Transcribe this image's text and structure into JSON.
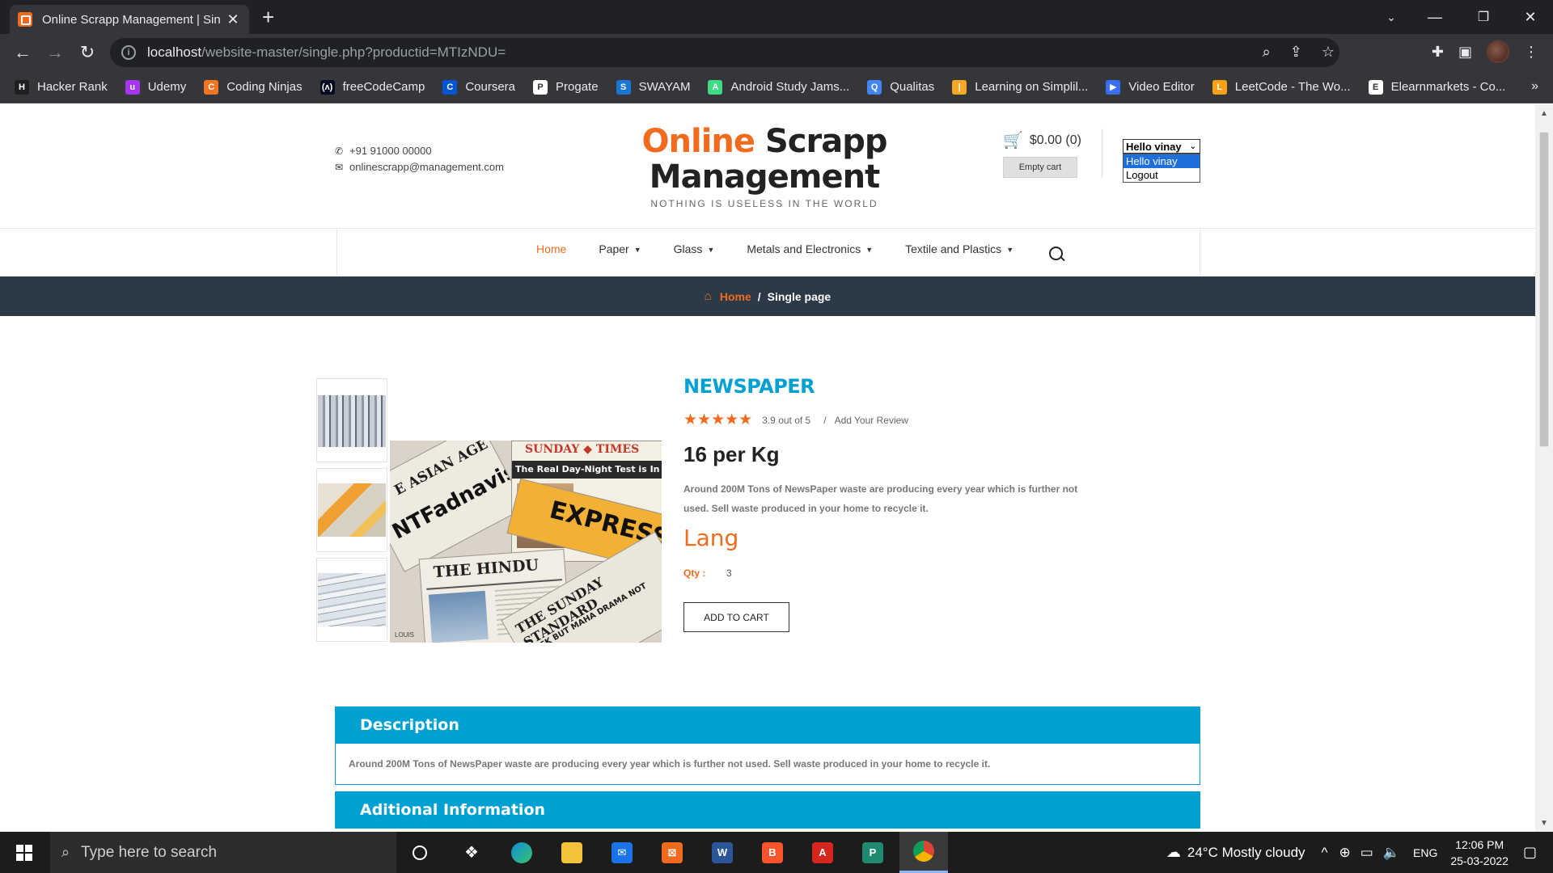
{
  "browser": {
    "tab_title": "Online Scrapp Management | Sin",
    "url_host": "localhost",
    "url_path": "/website-master/single.php?productid=MTIzNDU=",
    "bookmarks": [
      {
        "label": "Hacker Rank",
        "icon": "hackerrank-icon",
        "color": "#1f1f1f",
        "glyph": "H"
      },
      {
        "label": "Udemy",
        "icon": "udemy-icon",
        "color": "#a435f0",
        "glyph": "u"
      },
      {
        "label": "Coding Ninjas",
        "icon": "codingninjas-icon",
        "color": "#f47521",
        "glyph": "C"
      },
      {
        "label": "freeCodeCamp",
        "icon": "freecodecamp-icon",
        "color": "#0a0a23",
        "glyph": "(ʌ)"
      },
      {
        "label": "Coursera",
        "icon": "coursera-icon",
        "color": "#0056d2",
        "glyph": "C"
      },
      {
        "label": "Progate",
        "icon": "progate-icon",
        "color": "#ffffff",
        "glyph": "P"
      },
      {
        "label": "SWAYAM",
        "icon": "swayam-icon",
        "color": "#1976d2",
        "glyph": "S"
      },
      {
        "label": "Android Study Jams...",
        "icon": "android-icon",
        "color": "#3ddc84",
        "glyph": "A"
      },
      {
        "label": "Qualitas",
        "icon": "qualitas-icon",
        "color": "#4285f4",
        "glyph": "Q"
      },
      {
        "label": "Learning on Simplil...",
        "icon": "simplilearn-icon",
        "color": "#f9a825",
        "glyph": "|"
      },
      {
        "label": "Video Editor",
        "icon": "video-editor-icon",
        "color": "#3b6ef5",
        "glyph": "▶"
      },
      {
        "label": "LeetCode - The Wo...",
        "icon": "leetcode-icon",
        "color": "#ffa116",
        "glyph": "L"
      },
      {
        "label": "Elearnmarkets - Co...",
        "icon": "elearnmarkets-icon",
        "color": "#ffffff",
        "glyph": "E"
      }
    ]
  },
  "header": {
    "phone": "+91 91000 00000",
    "email": "onlinescrapp@management.com",
    "logo_word1": "Online",
    "logo_word2": "Scrapp",
    "logo_line2": "Management",
    "tagline": "NOTHING IS USELESS IN THE WORLD",
    "cart_amount": "$0.00 (0)",
    "empty_cart": "Empty cart",
    "user_select": "Hello vinay",
    "user_options": [
      "Hello vinay",
      "Logout"
    ]
  },
  "nav": {
    "items": [
      {
        "label": "Home",
        "caret": false
      },
      {
        "label": "Paper",
        "caret": true
      },
      {
        "label": "Glass",
        "caret": true
      },
      {
        "label": "Metals and Electronics",
        "caret": true
      },
      {
        "label": "Textile and Plastics",
        "caret": true
      }
    ]
  },
  "breadcrumb": {
    "home": "Home",
    "separator": "/",
    "current": "Single page"
  },
  "product": {
    "title": "NEWSPAPER",
    "rating_value": 5,
    "rating_text": "3.9 out of 5",
    "review_sep": "/",
    "review_link": "Add Your Review",
    "price": "16 per Kg",
    "description": "Around 200M Tons of NewsPaper waste are producing every year which is further not used. Sell waste produced in your home to recycle it.",
    "lang": "Lang",
    "qty_label": "Qty :",
    "qty_value": "3",
    "add_to_cart": "ADD TO CART",
    "image_texts": {
      "asian_age": "E ASIAN AGE",
      "fadnavis": "NTFadnavis",
      "sunday_times": "SUNDAY ◆ TIMES",
      "test_headline": "The Real Day-Night Test is In Mumbai",
      "express": "EXPRESS",
      "hindu": "THE HINDU",
      "sunday_standard": "THE SUNDAY STANDARD",
      "maha": "BACK BUT MAHA DRAMA NOT",
      "louis": "LOUIS"
    }
  },
  "tabs": {
    "description_title": "Description",
    "description_text": "Around 200M Tons of NewsPaper waste are producing every year which is further not used. Sell waste produced in your home to recycle it.",
    "additional_title": "Aditional Information"
  },
  "taskbar": {
    "search_placeholder": "Type here to search",
    "weather": "24°C  Mostly cloudy",
    "language": "ENG",
    "time": "12:06 PM",
    "date": "25-03-2022"
  }
}
